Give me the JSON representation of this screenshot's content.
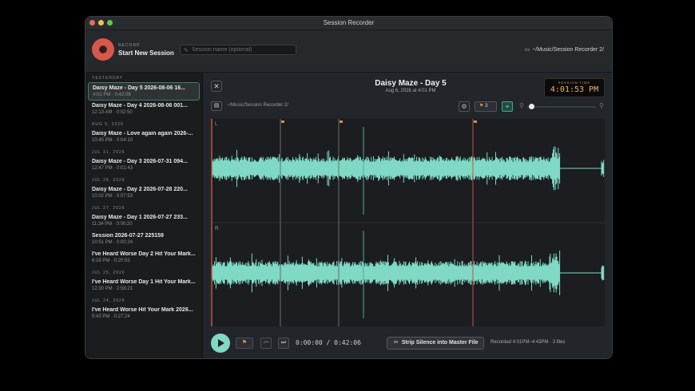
{
  "window": {
    "title": "Session Recorder",
    "traffic_colors": [
      "#ec6a5e",
      "#f4bf4f",
      "#61c554"
    ]
  },
  "header": {
    "record_label": "RECORD",
    "record_title": "Start New Session",
    "session_placeholder": "Session name (optional)",
    "folder_path": "~/Music/Session Recorder 2/"
  },
  "sidebar": {
    "groups": [
      {
        "label": "YESTERDAY",
        "items": [
          {
            "title": "Daisy Maze - Day 5 2026-08-06 16...",
            "meta": "4:01 PM · 0:42:06",
            "selected": true
          },
          {
            "title": "Daisy Maze - Day 4 2026-08-06 001...",
            "meta": "12:13 AM · 0:02:50"
          }
        ]
      },
      {
        "label": "AUG 5, 2026",
        "items": [
          {
            "title": "Daisy Maze - Love again again 2026-...",
            "meta": "10:45 PM · 0:04:10"
          }
        ]
      },
      {
        "label": "JUL 31, 2026",
        "items": [
          {
            "title": "Daisy Maze - Day 3 2026-07-31 094...",
            "meta": "12:47 PM · 0:01:43"
          }
        ]
      },
      {
        "label": "JUL 28, 2026",
        "items": [
          {
            "title": "Daisy Maze - Day 2 2026-07-28 220...",
            "meta": "10:02 PM · 0:07:53"
          }
        ]
      },
      {
        "label": "JUL 27, 2026",
        "items": [
          {
            "title": "Daisy Maze - Day 1 2026-07-27 233...",
            "meta": "11:34 PM · 0:00:20"
          },
          {
            "title": "Session 2026-07-27 225159",
            "meta": "10:51 PM · 0:00:24"
          },
          {
            "title": "I've Heard Worse Day 2 Hit Your Mark...",
            "meta": "6:18 PM · 0:20:55"
          }
        ]
      },
      {
        "label": "JUL 25, 2026",
        "items": [
          {
            "title": "I've Heard Worse Day 1 Hit Your Mark...",
            "meta": "12:30 PM · 2:58:21"
          }
        ]
      },
      {
        "label": "JUL 24, 2026",
        "items": [
          {
            "title": "I've Heard Worse Hit Your Mark 2026...",
            "meta": "9:43 PM · 0:27:24"
          }
        ]
      }
    ]
  },
  "recording": {
    "name": "Daisy Maze - Day 5",
    "date": "Aug 6, 2026 at 4:01 PM",
    "session_time_label": "SESSION TIME",
    "session_time": "4:01:53 PM",
    "path": "~/Music/Session Recorder 2/",
    "flag_count": "3",
    "zoom_level": 0.0
  },
  "waveform": {
    "channel_left_label": "L",
    "channel_right_label": "R",
    "wave_color": "#7fd9c4",
    "flag_color": "#d98a4a",
    "playhead_color": "#c0573f"
  },
  "transport": {
    "timecode": "0:00:00 / 0:42:06",
    "strip_label": "Strip Silence into Master File",
    "recorded_info": "Recorded 4:01PM–4:43PM · 3 files"
  }
}
